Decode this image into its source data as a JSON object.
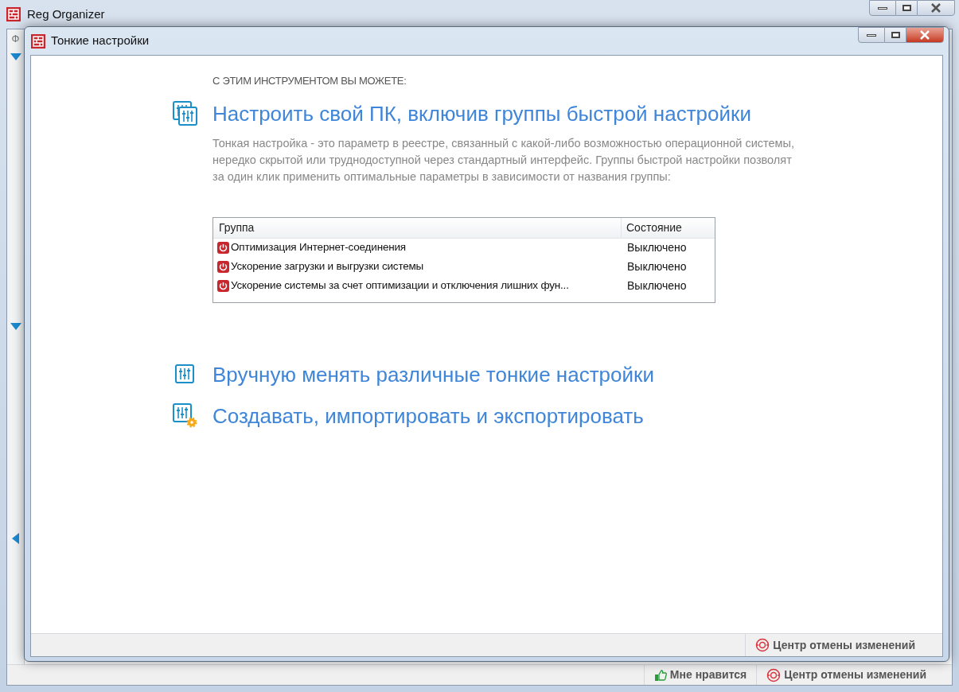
{
  "main_window": {
    "title": "Reg Organizer",
    "menu_fragment": "Ф",
    "status_bar": [
      {
        "kind": "like",
        "label": "Мне нравится"
      },
      {
        "kind": "undo",
        "label": "Центр отмены изменений"
      }
    ]
  },
  "dialog": {
    "title": "Тонкие настройки",
    "intro": "С ЭТИМ ИНСТРУМЕНТОМ ВЫ МОЖЕТЕ:",
    "options": [
      {
        "kind": "groups",
        "title": "Настроить свой ПК, включив группы быстрой настройки",
        "description": "Тонкая настройка - это параметр в реестре, связанный с какой-либо возможностью операционной системы, нередко скрытой или труднодоступной через стандартный интерфейс. Группы быстрой настройки позволят за один клик применить оптимальные параметры в зависимости от названия группы:",
        "table": {
          "columns": [
            "Группа",
            "Состояние"
          ],
          "rows": [
            {
              "group": "Оптимизация Интернет-соединения",
              "state": "Выключено",
              "enabled": false
            },
            {
              "group": "Ускорение загрузки и выгрузки системы",
              "state": "Выключено",
              "enabled": false
            },
            {
              "group": "Ускорение системы за счет оптимизации и отключения лишних фун...",
              "state": "Выключено",
              "enabled": false
            }
          ]
        }
      },
      {
        "kind": "manual",
        "title": "Вручную менять различные тонкие настройки"
      },
      {
        "kind": "create",
        "title": "Создавать, импортировать и экспортировать"
      }
    ],
    "status_bar": [
      {
        "kind": "undo",
        "label": "Центр отмены изменений"
      }
    ]
  }
}
